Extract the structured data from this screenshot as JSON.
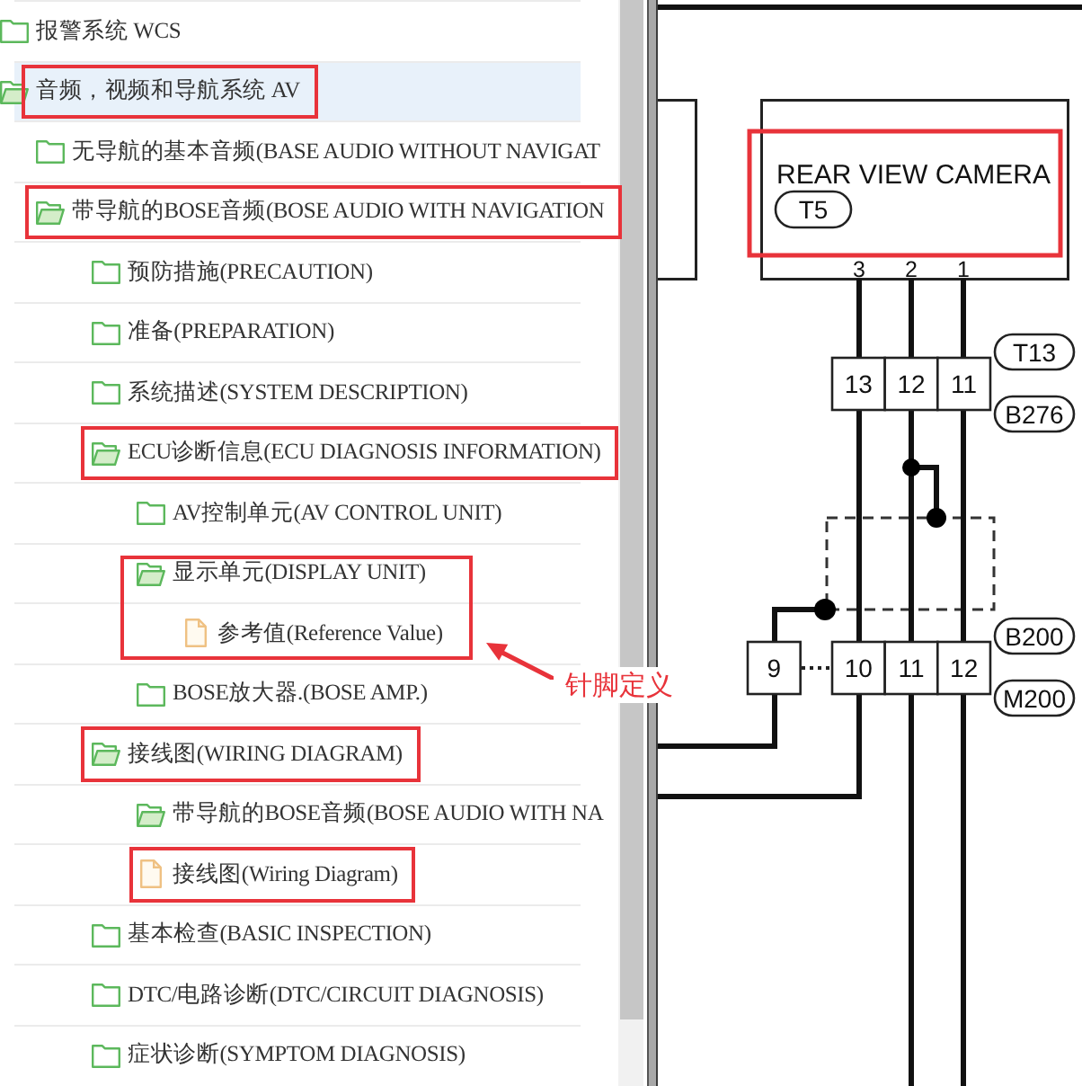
{
  "tree": {
    "items": [
      {
        "label": "报警系统 WCS",
        "kind": "folder",
        "expanded": false,
        "selected": false,
        "outlined": false
      },
      {
        "label": "音频，视频和导航系统 AV",
        "kind": "folder",
        "expanded": true,
        "selected": true,
        "outlined": true,
        "children": [
          {
            "label": "无导航的基本音频(BASE AUDIO WITHOUT NAVIGAT",
            "kind": "folder",
            "expanded": false,
            "selected": false,
            "outlined": false
          },
          {
            "label": "带导航的BOSE音频(BOSE AUDIO WITH NAVIGATION",
            "kind": "folder",
            "expanded": true,
            "selected": false,
            "outlined": true,
            "children": [
              {
                "label": "预防措施(PRECAUTION)",
                "kind": "folder",
                "expanded": false,
                "selected": false,
                "outlined": false
              },
              {
                "label": "准备(PREPARATION)",
                "kind": "folder",
                "expanded": false,
                "selected": false,
                "outlined": false
              },
              {
                "label": "系统描述(SYSTEM DESCRIPTION)",
                "kind": "folder",
                "expanded": false,
                "selected": false,
                "outlined": false
              },
              {
                "label": "ECU诊断信息(ECU DIAGNOSIS INFORMATION)",
                "kind": "folder",
                "expanded": true,
                "selected": false,
                "outlined": true,
                "children": [
                  {
                    "label": "AV控制单元(AV CONTROL UNIT)",
                    "kind": "folder",
                    "expanded": false,
                    "selected": false,
                    "outlined": false
                  },
                  {
                    "label": "显示单元(DISPLAY UNIT)",
                    "kind": "folder",
                    "expanded": true,
                    "selected": false,
                    "outlined": false,
                    "branch_outlined": true,
                    "children": [
                      {
                        "label": "参考值(Reference Value)",
                        "kind": "file",
                        "selected": false,
                        "outlined": false,
                        "note": "针脚定义"
                      }
                    ]
                  },
                  {
                    "label": "BOSE放大器.(BOSE AMP.)",
                    "kind": "folder",
                    "expanded": false,
                    "selected": false,
                    "outlined": false
                  }
                ]
              },
              {
                "label": "接线图(WIRING DIAGRAM)",
                "kind": "folder",
                "expanded": true,
                "selected": false,
                "outlined": true,
                "children": [
                  {
                    "label": "带导航的BOSE音频(BOSE AUDIO WITH NA",
                    "kind": "folder",
                    "expanded": true,
                    "selected": false,
                    "outlined": false
                  },
                  {
                    "label": "接线图(Wiring Diagram)",
                    "kind": "file",
                    "selected": false,
                    "outlined": true
                  }
                ]
              },
              {
                "label": "基本检查(BASIC INSPECTION)",
                "kind": "folder",
                "expanded": false,
                "selected": false,
                "outlined": false
              },
              {
                "label": "DTC/电路诊断(DTC/CIRCUIT DIAGNOSIS)",
                "kind": "folder",
                "expanded": false,
                "selected": false,
                "outlined": false
              },
              {
                "label": "症状诊断(SYMPTOM DIAGNOSIS)",
                "kind": "folder",
                "expanded": false,
                "selected": false,
                "outlined": false
              }
            ]
          }
        ]
      }
    ]
  },
  "wiring_diagram": {
    "component": {
      "title": "REAR VIEW CAMERA",
      "connector": "T5",
      "pins": [
        "3",
        "2",
        "1"
      ],
      "outlined": true
    },
    "connectors": [
      {
        "kind": "inline",
        "pins": [
          "13",
          "12",
          "11"
        ],
        "labels": [
          "T13",
          "B276"
        ]
      },
      {
        "kind": "split",
        "pins": [
          "9",
          "10",
          "11",
          "12"
        ],
        "labels": [
          "B200",
          "M200"
        ]
      }
    ]
  }
}
